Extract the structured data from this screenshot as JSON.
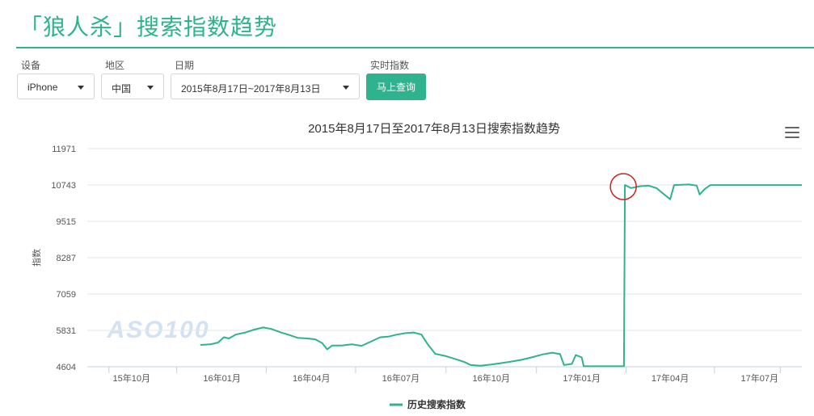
{
  "page": {
    "title": "「狼人杀」搜索指数趋势"
  },
  "filters": {
    "device_label": "设备",
    "device_value": "iPhone",
    "region_label": "地区",
    "region_value": "中国",
    "date_label": "日期",
    "date_value": "2015年8月17日~2017年8月13日",
    "realtime_label": "实时指数",
    "query_button": "马上查询"
  },
  "watermark": "ASO100",
  "chart_data": {
    "type": "line",
    "title": "2015年8月17日至2017年8月13日搜索指数趋势",
    "xlabel": "",
    "ylabel": "指数",
    "x_range": [
      "2015-08-17",
      "2017-08-13"
    ],
    "ylim": [
      4604,
      11971
    ],
    "yticks": [
      4604,
      5831,
      7059,
      8287,
      9515,
      10743,
      11971
    ],
    "xticks": [
      {
        "date": "2015-10-01",
        "label": "15年10月"
      },
      {
        "date": "2016-01-01",
        "label": "16年01月"
      },
      {
        "date": "2016-04-01",
        "label": "16年04月"
      },
      {
        "date": "2016-07-01",
        "label": "16年07月"
      },
      {
        "date": "2016-10-01",
        "label": "16年10月"
      },
      {
        "date": "2017-01-01",
        "label": "17年01月"
      },
      {
        "date": "2017-04-01",
        "label": "17年04月"
      },
      {
        "date": "2017-07-01",
        "label": "17年07月"
      }
    ],
    "grid": true,
    "legend": "bottom-center",
    "highlight": {
      "date": "2017-02-14",
      "value": 10743
    },
    "series": [
      {
        "name": "历史搜索指数",
        "color": "#2fb38e",
        "points": [
          [
            "2015-12-10",
            5340
          ],
          [
            "2015-12-20",
            5360
          ],
          [
            "2015-12-28",
            5420
          ],
          [
            "2016-01-03",
            5600
          ],
          [
            "2016-01-08",
            5560
          ],
          [
            "2016-01-15",
            5690
          ],
          [
            "2016-01-25",
            5760
          ],
          [
            "2016-02-03",
            5860
          ],
          [
            "2016-02-12",
            5930
          ],
          [
            "2016-02-20",
            5880
          ],
          [
            "2016-03-01",
            5760
          ],
          [
            "2016-03-10",
            5670
          ],
          [
            "2016-03-18",
            5580
          ],
          [
            "2016-03-28",
            5560
          ],
          [
            "2016-04-05",
            5530
          ],
          [
            "2016-04-12",
            5400
          ],
          [
            "2016-04-17",
            5190
          ],
          [
            "2016-04-22",
            5320
          ],
          [
            "2016-05-02",
            5320
          ],
          [
            "2016-05-12",
            5360
          ],
          [
            "2016-05-22",
            5310
          ],
          [
            "2016-06-01",
            5460
          ],
          [
            "2016-06-10",
            5600
          ],
          [
            "2016-06-18",
            5620
          ],
          [
            "2016-06-27",
            5690
          ],
          [
            "2016-07-06",
            5740
          ],
          [
            "2016-07-14",
            5760
          ],
          [
            "2016-07-22",
            5690
          ],
          [
            "2016-07-28",
            5380
          ],
          [
            "2016-08-05",
            5040
          ],
          [
            "2016-08-15",
            4970
          ],
          [
            "2016-08-25",
            4870
          ],
          [
            "2016-09-04",
            4760
          ],
          [
            "2016-09-10",
            4660
          ],
          [
            "2016-09-20",
            4640
          ],
          [
            "2016-10-01",
            4680
          ],
          [
            "2016-10-10",
            4720
          ],
          [
            "2016-10-20",
            4770
          ],
          [
            "2016-11-01",
            4840
          ],
          [
            "2016-11-12",
            4930
          ],
          [
            "2016-11-22",
            5020
          ],
          [
            "2016-12-02",
            5080
          ],
          [
            "2016-12-10",
            5030
          ],
          [
            "2016-12-14",
            4660
          ],
          [
            "2016-12-22",
            4700
          ],
          [
            "2016-12-26",
            5000
          ],
          [
            "2017-01-01",
            4920
          ],
          [
            "2017-01-03",
            4620
          ],
          [
            "2017-02-13",
            4620
          ],
          [
            "2017-02-14",
            10743
          ],
          [
            "2017-02-20",
            10640
          ],
          [
            "2017-03-01",
            10700
          ],
          [
            "2017-03-10",
            10720
          ],
          [
            "2017-03-18",
            10640
          ],
          [
            "2017-03-26",
            10420
          ],
          [
            "2017-04-01",
            10260
          ],
          [
            "2017-04-05",
            10740
          ],
          [
            "2017-04-20",
            10760
          ],
          [
            "2017-04-28",
            10720
          ],
          [
            "2017-05-01",
            10420
          ],
          [
            "2017-05-06",
            10600
          ],
          [
            "2017-05-12",
            10740
          ],
          [
            "2017-08-13",
            10740
          ]
        ]
      }
    ]
  }
}
